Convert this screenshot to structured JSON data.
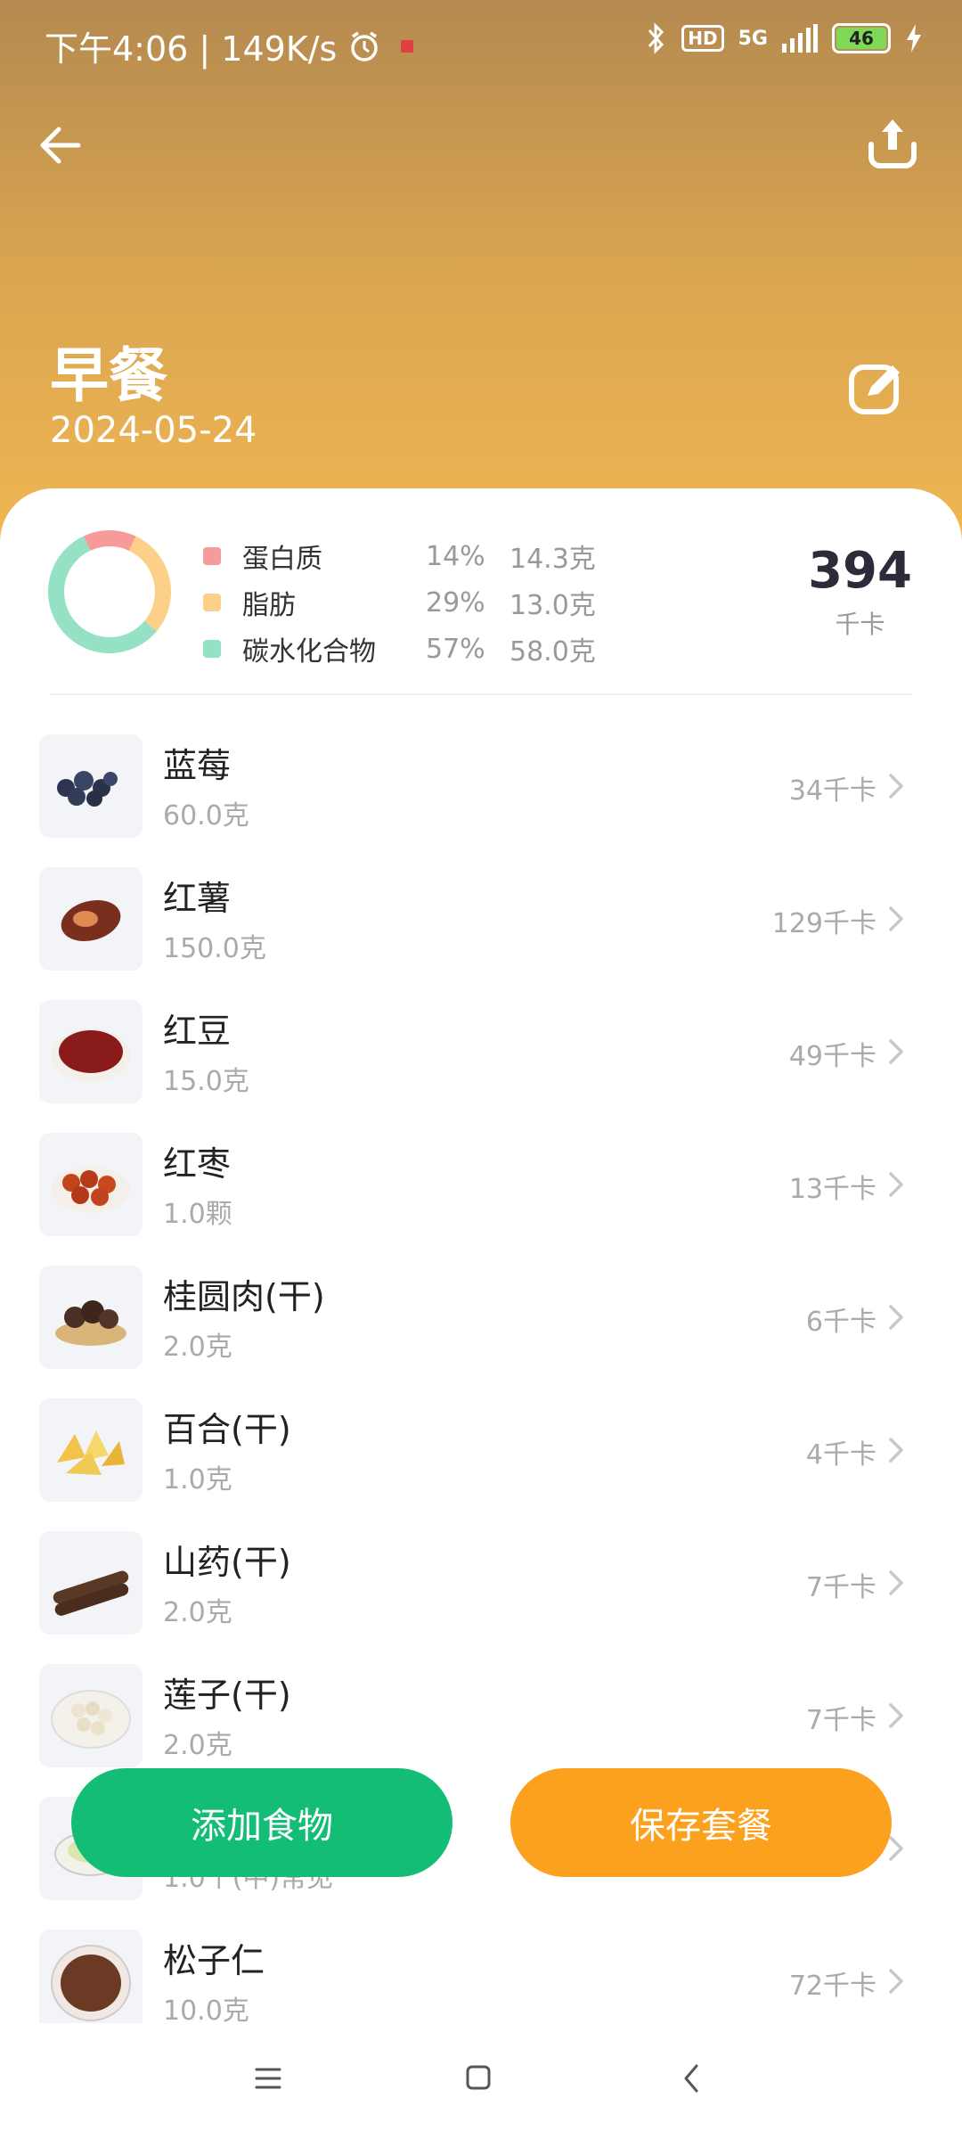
{
  "status_bar": {
    "time_speed": "下午4:06 | 149K/s",
    "network": "5G",
    "hd": "HD",
    "battery": "46"
  },
  "header": {
    "title": "早餐",
    "date": "2024-05-24"
  },
  "summary": {
    "macros": [
      {
        "name": "蛋白质",
        "percent": "14%",
        "amount": "14.3克",
        "color": "#f69a9a",
        "fraction": 0.14
      },
      {
        "name": "脂肪",
        "percent": "29%",
        "amount": "13.0克",
        "color": "#fcd088",
        "fraction": 0.29
      },
      {
        "name": "碳水化合物",
        "percent": "57%",
        "amount": "58.0克",
        "color": "#95e1c3",
        "fraction": 0.57
      }
    ],
    "kcal_value": "394",
    "kcal_unit": "千卡"
  },
  "foods": [
    {
      "name": "蓝莓",
      "amount": "60.0克",
      "kcal": "34千卡",
      "icon": "blueberry-icon"
    },
    {
      "name": "红薯",
      "amount": "150.0克",
      "kcal": "129千卡",
      "icon": "sweet-potato-icon"
    },
    {
      "name": "红豆",
      "amount": "15.0克",
      "kcal": "49千卡",
      "icon": "red-bean-icon"
    },
    {
      "name": "红枣",
      "amount": "1.0颗",
      "kcal": "13千卡",
      "icon": "red-date-icon"
    },
    {
      "name": "桂圆肉(干)",
      "amount": "2.0克",
      "kcal": "6千卡",
      "icon": "longan-icon"
    },
    {
      "name": "百合(干)",
      "amount": "1.0克",
      "kcal": "4千卡",
      "icon": "lily-icon"
    },
    {
      "name": "山药(干)",
      "amount": "2.0克",
      "kcal": "7千卡",
      "icon": "yam-icon"
    },
    {
      "name": "莲子(干)",
      "amount": "2.0克",
      "kcal": "7千卡",
      "icon": "lotus-seed-icon"
    },
    {
      "name": "",
      "amount": "1.0个(中)常见",
      "kcal": "",
      "icon": "bowl-icon"
    },
    {
      "name": "松子仁",
      "amount": "10.0克",
      "kcal": "72千卡",
      "icon": "pine-nut-icon"
    }
  ],
  "buttons": {
    "add_food": "添加食物",
    "save_meal": "保存套餐"
  }
}
